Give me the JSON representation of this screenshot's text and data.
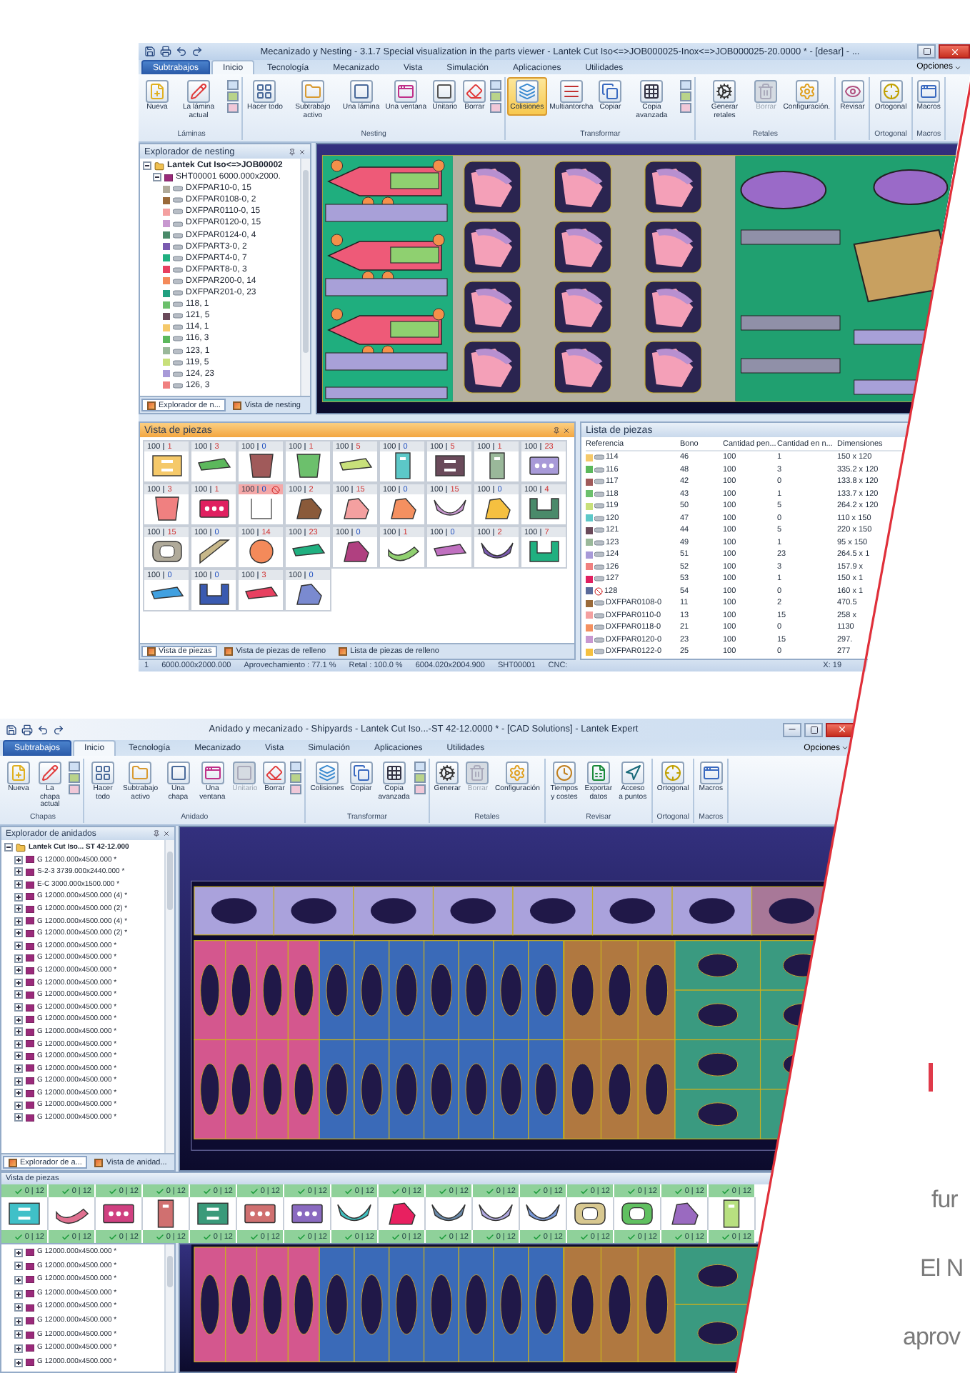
{
  "nesting_window": {
    "title": "Mecanizado y Nesting - 3.1.7 Special visualization in the parts viewer - Lantek Cut Iso<=>JOB000025-Inox<=>JOB000025-20.0000 * - [desar] - ...",
    "tabs": [
      {
        "label": "Subtrabajos",
        "kind": "file",
        "selected": false
      },
      {
        "label": "Inicio",
        "kind": "tab",
        "selected": true
      },
      {
        "label": "Tecnología",
        "kind": "tab",
        "selected": false
      },
      {
        "label": "Mecanizado",
        "kind": "tab",
        "selected": false
      },
      {
        "label": "Vista",
        "kind": "tab",
        "selected": false
      },
      {
        "label": "Simulación",
        "kind": "tab",
        "selected": false
      },
      {
        "label": "Aplicaciones",
        "kind": "tab",
        "selected": false
      },
      {
        "label": "Utilidades",
        "kind": "tab",
        "selected": false
      }
    ],
    "options": "Opciones",
    "ribbon": [
      {
        "label": "Láminas",
        "buttons": [
          {
            "label": "Nueva",
            "selected": false,
            "disabled": false
          },
          {
            "label": "La lámina actual",
            "selected": false,
            "disabled": false
          }
        ]
      },
      {
        "label": "Nesting",
        "buttons": [
          {
            "label": "Hacer todo",
            "selected": false,
            "disabled": false
          },
          {
            "label": "Subtrabajo activo",
            "selected": false,
            "disabled": false
          },
          {
            "label": "Una lámina",
            "selected": false,
            "disabled": false
          },
          {
            "label": "Una ventana",
            "selected": false,
            "disabled": false
          },
          {
            "label": "Unitario",
            "selected": false,
            "disabled": false
          },
          {
            "label": "Borrar",
            "selected": false,
            "disabled": false
          }
        ]
      },
      {
        "label": "Transformar",
        "buttons": [
          {
            "label": "Colisiones",
            "selected": true,
            "disabled": false
          },
          {
            "label": "Multiantorcha",
            "selected": false,
            "disabled": false
          },
          {
            "label": "Copiar",
            "selected": false,
            "disabled": false
          },
          {
            "label": "Copia avanzada",
            "selected": false,
            "disabled": false
          }
        ]
      },
      {
        "label": "Retales",
        "buttons": [
          {
            "label": "Generar retales",
            "selected": false,
            "disabled": false
          },
          {
            "label": "Borrar",
            "selected": false,
            "disabled": true
          },
          {
            "label": "Configuración.",
            "selected": false,
            "disabled": false
          }
        ]
      },
      {
        "buttons": [
          {
            "label": "Revisar",
            "selected": false,
            "disabled": false
          }
        ]
      },
      {
        "label": "Ortogonal",
        "buttons": [
          {
            "label": "Ortogonal",
            "selected": false,
            "disabled": false
          }
        ]
      },
      {
        "label": "Macros",
        "buttons": [
          {
            "label": "Macros",
            "selected": false,
            "disabled": false
          }
        ]
      }
    ],
    "explorer": {
      "title": "Explorador de nesting",
      "tree": [
        {
          "label": "Lantek Cut Iso<=>JOB00002",
          "expanded": true,
          "children": [
            {
              "label": "SHT00001 6000.000x2000.",
              "expanded": true,
              "children": [
                {
                  "label": "DXFPAR10-0, 15",
                  "color": "#b0aa9a"
                },
                {
                  "label": "DXFPAR0108-0, 2",
                  "color": "#9a6a3a"
                },
                {
                  "label": "DXFPAR0110-0, 15",
                  "color": "#f4a0a0"
                },
                {
                  "label": "DXFPAR0120-0, 15",
                  "color": "#c898d0"
                },
                {
                  "label": "DXFPAR0124-0, 4",
                  "color": "#4a8a6a"
                },
                {
                  "label": "DXFPART3-0, 2",
                  "color": "#7a5ab0"
                },
                {
                  "label": "DXFPART4-0, 7",
                  "color": "#20b080"
                },
                {
                  "label": "DXFPART8-0, 3",
                  "color": "#e84060"
                },
                {
                  "label": "DXFPAR200-0, 14",
                  "color": "#f48a5a"
                },
                {
                  "label": "DXFPAR201-0, 23",
                  "color": "#20a080"
                },
                {
                  "label": "118, 1",
                  "color": "#6cc06c"
                },
                {
                  "label": "121, 5",
                  "color": "#6a4a5a"
                },
                {
                  "label": "114, 1",
                  "color": "#f5c96a"
                },
                {
                  "label": "116, 3",
                  "color": "#5cb85c"
                },
                {
                  "label": "123, 1",
                  "color": "#9ab89a"
                },
                {
                  "label": "119, 5",
                  "color": "#c8e07a"
                },
                {
                  "label": "124, 23",
                  "color": "#a89ad8"
                },
                {
                  "label": "126, 3",
                  "color": "#f08080"
                }
              ]
            }
          ]
        }
      ],
      "tabs": [
        {
          "label": "Explorador de n...",
          "selected": true
        },
        {
          "label": "Vista de nesting",
          "selected": false
        }
      ]
    },
    "parts_view": {
      "title": "Vista de piezas",
      "tiles": [
        {
          "quantity": "100",
          "remaining": "1",
          "done": false,
          "blocked": false,
          "kind": "rect",
          "color": "#f5c96a"
        },
        {
          "quantity": "100",
          "remaining": "3",
          "done": false,
          "blocked": false,
          "kind": "strip",
          "color": "#5cb85c"
        },
        {
          "quantity": "100",
          "remaining": "0",
          "done": true,
          "blocked": false,
          "kind": "trapezoid",
          "color": "#a05a5a"
        },
        {
          "quantity": "100",
          "remaining": "1",
          "done": false,
          "blocked": false,
          "kind": "trapezoid",
          "color": "#6cc06c"
        },
        {
          "quantity": "100",
          "remaining": "5",
          "done": false,
          "blocked": false,
          "kind": "strip",
          "color": "#c8e07a"
        },
        {
          "quantity": "100",
          "remaining": "0",
          "done": true,
          "blocked": false,
          "kind": "tall",
          "color": "#5cc8c8"
        },
        {
          "quantity": "100",
          "remaining": "5",
          "done": false,
          "blocked": false,
          "kind": "rect",
          "color": "#6a4a5a"
        },
        {
          "quantity": "100",
          "remaining": "1",
          "done": false,
          "blocked": false,
          "kind": "tall",
          "color": "#9ab89a"
        },
        {
          "quantity": "100",
          "remaining": "23",
          "done": false,
          "blocked": false,
          "kind": "dots",
          "color": "#a89ad8"
        },
        {
          "quantity": "100",
          "remaining": "3",
          "done": false,
          "blocked": false,
          "kind": "trapezoid",
          "color": "#f08080"
        },
        {
          "quantity": "100",
          "remaining": "1",
          "done": false,
          "blocked": false,
          "kind": "dots",
          "color": "#e02060"
        },
        {
          "quantity": "100",
          "remaining": "0",
          "done": true,
          "blocked": true,
          "kind": "empty"
        },
        {
          "quantity": "100",
          "remaining": "2",
          "done": false,
          "blocked": false,
          "kind": "blob",
          "color": "#8a5a3a"
        },
        {
          "quantity": "100",
          "remaining": "15",
          "done": false,
          "blocked": false,
          "kind": "blob",
          "color": "#f4a0a0"
        },
        {
          "quantity": "100",
          "remaining": "0",
          "done": true,
          "blocked": false,
          "kind": "blob",
          "color": "#f49060"
        },
        {
          "quantity": "100",
          "remaining": "15",
          "done": false,
          "blocked": false,
          "kind": "arc",
          "color": "#c898d0"
        },
        {
          "quantity": "100",
          "remaining": "0",
          "done": true,
          "blocked": false,
          "kind": "blob",
          "color": "#f5c040"
        },
        {
          "quantity": "100",
          "remaining": "4",
          "done": false,
          "blocked": false,
          "kind": "u",
          "color": "#4a8a6a"
        },
        {
          "quantity": "100",
          "remaining": "15",
          "done": false,
          "blocked": false,
          "kind": "ring",
          "color": "#b0aa9a"
        },
        {
          "quantity": "100",
          "remaining": "0",
          "done": true,
          "blocked": false,
          "kind": "triangle",
          "color": "#c8b88a"
        },
        {
          "quantity": "100",
          "remaining": "14",
          "done": false,
          "blocked": false,
          "kind": "circle",
          "color": "#f48a5a"
        },
        {
          "quantity": "100",
          "remaining": "23",
          "done": false,
          "blocked": false,
          "kind": "strip",
          "color": "#20b080"
        },
        {
          "quantity": "100",
          "remaining": "0",
          "done": true,
          "blocked": false,
          "kind": "blob",
          "color": "#b04080"
        },
        {
          "quantity": "100",
          "remaining": "1",
          "done": false,
          "blocked": false,
          "kind": "hook",
          "color": "#90d070"
        },
        {
          "quantity": "100",
          "remaining": "0",
          "done": true,
          "blocked": false,
          "kind": "strip",
          "color": "#c070c0"
        },
        {
          "quantity": "100",
          "remaining": "2",
          "done": false,
          "blocked": false,
          "kind": "arc",
          "color": "#7a5ab0"
        },
        {
          "quantity": "100",
          "remaining": "7",
          "done": false,
          "blocked": false,
          "kind": "u",
          "color": "#20b080"
        },
        {
          "quantity": "100",
          "remaining": "0",
          "done": true,
          "blocked": false,
          "kind": "strip",
          "color": "#40a0e0"
        },
        {
          "quantity": "100",
          "remaining": "0",
          "done": true,
          "blocked": false,
          "kind": "u",
          "color": "#3a5ab0"
        },
        {
          "quantity": "100",
          "remaining": "3",
          "done": false,
          "blocked": false,
          "kind": "strip",
          "color": "#e84060"
        },
        {
          "quantity": "100",
          "remaining": "0",
          "done": true,
          "blocked": false,
          "kind": "blob",
          "color": "#7a8ad0"
        }
      ],
      "tabs": [
        {
          "label": "Vista de piezas",
          "selected": true
        },
        {
          "label": "Vista de piezas de relleno",
          "selected": false
        },
        {
          "label": "Lista de piezas de relleno",
          "selected": false
        }
      ]
    },
    "parts_list": {
      "title": "Lista de piezas",
      "columns": [
        "Referencia",
        "Bono",
        "Cantidad pen...",
        "Cantidad en n...",
        "Dimensiones"
      ],
      "rows": [
        {
          "color": "#f5c96a",
          "blocked": false,
          "cells": [
            "114",
            "46",
            "100",
            "1",
            "150 x 120"
          ]
        },
        {
          "color": "#5cb85c",
          "blocked": false,
          "cells": [
            "116",
            "48",
            "100",
            "3",
            "335.2 x 120"
          ]
        },
        {
          "color": "#a05a5a",
          "blocked": false,
          "cells": [
            "117",
            "42",
            "100",
            "0",
            "133.8 x 120"
          ]
        },
        {
          "color": "#6cc06c",
          "blocked": false,
          "cells": [
            "118",
            "43",
            "100",
            "1",
            "133.7 x 120"
          ]
        },
        {
          "color": "#c8e07a",
          "blocked": false,
          "cells": [
            "119",
            "50",
            "100",
            "5",
            "264.2 x 120"
          ]
        },
        {
          "color": "#5cc8c8",
          "blocked": false,
          "cells": [
            "120",
            "47",
            "100",
            "0",
            "110 x 150"
          ]
        },
        {
          "color": "#6a4a5a",
          "blocked": false,
          "cells": [
            "121",
            "44",
            "100",
            "5",
            "220 x 150"
          ]
        },
        {
          "color": "#9ab89a",
          "blocked": false,
          "cells": [
            "123",
            "49",
            "100",
            "1",
            "95 x 150"
          ]
        },
        {
          "color": "#a89ad8",
          "blocked": false,
          "cells": [
            "124",
            "51",
            "100",
            "23",
            "264.5 x 1"
          ]
        },
        {
          "color": "#f08080",
          "blocked": false,
          "cells": [
            "126",
            "52",
            "100",
            "3",
            "157.9 x"
          ]
        },
        {
          "color": "#e02060",
          "blocked": false,
          "cells": [
            "127",
            "53",
            "100",
            "1",
            "150 x 1"
          ]
        },
        {
          "color": "#5a6a9a",
          "blocked": true,
          "cells": [
            "128",
            "54",
            "100",
            "0",
            "160 x 1"
          ]
        },
        {
          "color": "#9a6a3a",
          "blocked": false,
          "cells": [
            "DXFPAR0108-0",
            "11",
            "100",
            "2",
            "470.5"
          ]
        },
        {
          "color": "#f4a0a0",
          "blocked": false,
          "cells": [
            "DXFPAR0110-0",
            "13",
            "100",
            "15",
            "258 x"
          ]
        },
        {
          "color": "#f49060",
          "blocked": false,
          "cells": [
            "DXFPAR0118-0",
            "21",
            "100",
            "0",
            "1130"
          ]
        },
        {
          "color": "#c898d0",
          "blocked": false,
          "cells": [
            "DXFPAR0120-0",
            "23",
            "100",
            "15",
            "297."
          ]
        },
        {
          "color": "#f5c040",
          "blocked": false,
          "cells": [
            "DXFPAR0122-0",
            "25",
            "100",
            "0",
            "277"
          ]
        }
      ]
    },
    "status_bar": [
      "1",
      "6000.000x2000.000",
      "Aprovechamiento : 77.1 %",
      "Retal : 100.0 %",
      "6004.020x2004.900",
      "SHT00001",
      "CNC:",
      "X: 19"
    ]
  },
  "shipyard_window": {
    "title": "Anidado y mecanizado - Shipyards - Lantek Cut Iso...-ST 42-12.0000 * - [CAD Solutions] - Lantek Expert",
    "tabs": [
      {
        "label": "Subtrabajos",
        "kind": "file",
        "selected": false
      },
      {
        "label": "Inicio",
        "kind": "tab",
        "selected": true
      },
      {
        "label": "Tecnología",
        "kind": "tab",
        "selected": false
      },
      {
        "label": "Mecanizado",
        "kind": "tab",
        "selected": false
      },
      {
        "label": "Vista",
        "kind": "tab",
        "selected": false
      },
      {
        "label": "Simulación",
        "kind": "tab",
        "selected": false
      },
      {
        "label": "Aplicaciones",
        "kind": "tab",
        "selected": false
      },
      {
        "label": "Utilidades",
        "kind": "tab",
        "selected": false
      }
    ],
    "options": "Opciones",
    "ribbon": [
      {
        "label": "Chapas",
        "buttons": [
          {
            "label": "Nueva",
            "selected": false,
            "disabled": false
          },
          {
            "label": "La chapa actual",
            "selected": false,
            "disabled": false
          }
        ]
      },
      {
        "label": "Anidado",
        "buttons": [
          {
            "label": "Hacer todo",
            "selected": false,
            "disabled": false
          },
          {
            "label": "Subtrabajo activo",
            "selected": false,
            "disabled": false
          },
          {
            "label": "Una chapa",
            "selected": false,
            "disabled": false
          },
          {
            "label": "Una ventana",
            "selected": false,
            "disabled": false
          },
          {
            "label": "Unitario",
            "selected": false,
            "disabled": true
          },
          {
            "label": "Borrar",
            "selected": false,
            "disabled": false
          }
        ]
      },
      {
        "label": "Transformar",
        "buttons": [
          {
            "label": "Colisiones",
            "selected": false,
            "disabled": false
          },
          {
            "label": "Copiar",
            "selected": false,
            "disabled": false
          },
          {
            "label": "Copia avanzada",
            "selected": false,
            "disabled": false
          }
        ]
      },
      {
        "label": "Retales",
        "buttons": [
          {
            "label": "Generar",
            "selected": false,
            "disabled": false
          },
          {
            "label": "Borrar",
            "selected": false,
            "disabled": true
          },
          {
            "label": "Configuración",
            "selected": false,
            "disabled": false
          }
        ]
      },
      {
        "label": "Revisar",
        "buttons": [
          {
            "label": "Tiempos y costes",
            "selected": false,
            "disabled": false
          },
          {
            "label": "Exportar datos",
            "selected": false,
            "disabled": false
          },
          {
            "label": "Acceso a puntos",
            "selected": false,
            "disabled": false
          }
        ]
      },
      {
        "label": "Ortogonal",
        "buttons": [
          {
            "label": "Ortogonal",
            "selected": false,
            "disabled": false
          }
        ]
      },
      {
        "label": "Macros",
        "buttons": [
          {
            "label": "Macros",
            "selected": false,
            "disabled": false
          }
        ]
      }
    ],
    "explorer": {
      "title": "Explorador de anidados",
      "tree": [
        {
          "label": "Lantek Cut Iso... ST 42-12.000",
          "expanded": true,
          "children": [
            {
              "label": "G 12000.000x4500.000 *",
              "expanded": false
            },
            {
              "label": "S-2-3 3739.000x2440.000 *",
              "expanded": false
            },
            {
              "label": "E-C 3000.000x1500.000 *",
              "expanded": false
            },
            {
              "label": "G 12000.000x4500.000 (4) *",
              "expanded": false
            },
            {
              "label": "G 12000.000x4500.000 (2) *",
              "expanded": false
            },
            {
              "label": "G 12000.000x4500.000 (4) *",
              "expanded": false
            },
            {
              "label": "G 12000.000x4500.000 (2) *",
              "expanded": false
            },
            {
              "label": "G 12000.000x4500.000 *",
              "expanded": false
            },
            {
              "label": "G 12000.000x4500.000 *",
              "expanded": false
            },
            {
              "label": "G 12000.000x4500.000 *",
              "expanded": false
            },
            {
              "label": "G 12000.000x4500.000 *",
              "expanded": false
            },
            {
              "label": "G 12000.000x4500.000 *",
              "expanded": false
            },
            {
              "label": "G 12000.000x4500.000 *",
              "expanded": false
            },
            {
              "label": "G 12000.000x4500.000 *",
              "expanded": false
            },
            {
              "label": "G 12000.000x4500.000 *",
              "expanded": false
            },
            {
              "label": "G 12000.000x4500.000 *",
              "expanded": false
            },
            {
              "label": "G 12000.000x4500.000 *",
              "expanded": false
            },
            {
              "label": "G 12000.000x4500.000 *",
              "expanded": false
            },
            {
              "label": "G 12000.000x4500.000 *",
              "expanded": false
            },
            {
              "label": "G 12000.000x4500.000 *",
              "expanded": false
            },
            {
              "label": "G 12000.000x4500.000 *",
              "expanded": false
            },
            {
              "label": "G 12000.000x4500.000 *",
              "expanded": false
            }
          ]
        }
      ],
      "tabs": [
        {
          "label": "Explorador de a...",
          "selected": true
        },
        {
          "label": "Vista de anidad...",
          "selected": false
        }
      ]
    },
    "parts_view": {
      "title": "Vista de piezas",
      "tiles": [
        {
          "label": "0 | 12",
          "done": true,
          "kind": "rect",
          "color": "#40c0c8"
        },
        {
          "label": "0 | 12",
          "done": true,
          "kind": "hook",
          "color": "#e07090"
        },
        {
          "label": "0 | 12",
          "done": true,
          "kind": "dots",
          "color": "#d04080"
        },
        {
          "label": "0 | 12",
          "done": true,
          "kind": "tall",
          "color": "#d07070"
        },
        {
          "label": "0 | 12",
          "done": true,
          "kind": "rect",
          "color": "#3a9a7a"
        },
        {
          "label": "0 | 12",
          "done": true,
          "kind": "dots",
          "color": "#d07070"
        },
        {
          "label": "0 | 12",
          "done": true,
          "kind": "dots",
          "color": "#8a6ac0"
        },
        {
          "label": "0 | 12",
          "done": true,
          "kind": "arc",
          "color": "#40c0c0"
        },
        {
          "label": "0 | 12",
          "done": true,
          "kind": "blob",
          "color": "#e82060"
        },
        {
          "label": "0 | 12",
          "done": true,
          "kind": "arc",
          "color": "#6a8aaa"
        },
        {
          "label": "0 | 12",
          "done": true,
          "kind": "arc",
          "color": "#b0a8e0"
        },
        {
          "label": "0 | 12",
          "done": true,
          "kind": "arc",
          "color": "#7a9ad8"
        },
        {
          "label": "0 | 12",
          "done": true,
          "kind": "ring",
          "color": "#d8c890"
        },
        {
          "label": "0 | 12",
          "done": true,
          "kind": "ring",
          "color": "#60c060"
        },
        {
          "label": "0 | 12",
          "done": true,
          "kind": "blob",
          "color": "#9a6ac0"
        },
        {
          "label": "0 | 12",
          "done": true,
          "kind": "tall",
          "color": "#b8e080"
        }
      ],
      "lower_labels": [
        {
          "label": "0 | 12",
          "done": true
        },
        {
          "label": "0 | 12",
          "done": true
        },
        {
          "label": "0 | 12",
          "done": true
        },
        {
          "label": "0 | 12",
          "done": true
        },
        {
          "label": "0 | 12",
          "done": true
        },
        {
          "label": "0 | 12",
          "done": true
        },
        {
          "label": "0 | 12",
          "done": true
        },
        {
          "label": "0 | 12",
          "done": true
        },
        {
          "label": "0 | 12",
          "done": true
        },
        {
          "label": "0 | 12",
          "done": true
        },
        {
          "label": "0 | 12",
          "done": true
        },
        {
          "label": "0 | 12",
          "done": true
        },
        {
          "label": "0 | 12",
          "done": true
        },
        {
          "label": "0 | 12",
          "done": true
        },
        {
          "label": "0 | 12",
          "done": true
        },
        {
          "label": "0 | 12",
          "done": true
        }
      ]
    },
    "lower_tree": [
      {
        "label": "G 12000.000x4500.000 *",
        "expanded": false
      },
      {
        "label": "G 12000.000x4500.000 *",
        "expanded": false
      },
      {
        "label": "G 12000.000x4500.000 *",
        "expanded": false
      },
      {
        "label": "G 12000.000x4500.000 *",
        "expanded": false
      },
      {
        "label": "G 12000.000x4500.000 *",
        "expanded": false
      },
      {
        "label": "G 12000.000x4500.000 *",
        "expanded": false
      },
      {
        "label": "G 12000.000x4500.000 *",
        "expanded": false
      },
      {
        "label": "G 12000.000x4500.000 *",
        "expanded": false
      },
      {
        "label": "G 12000.000x4500.000 *",
        "expanded": false
      }
    ]
  },
  "page_text": [
    "fur",
    "El N",
    "aprov"
  ]
}
